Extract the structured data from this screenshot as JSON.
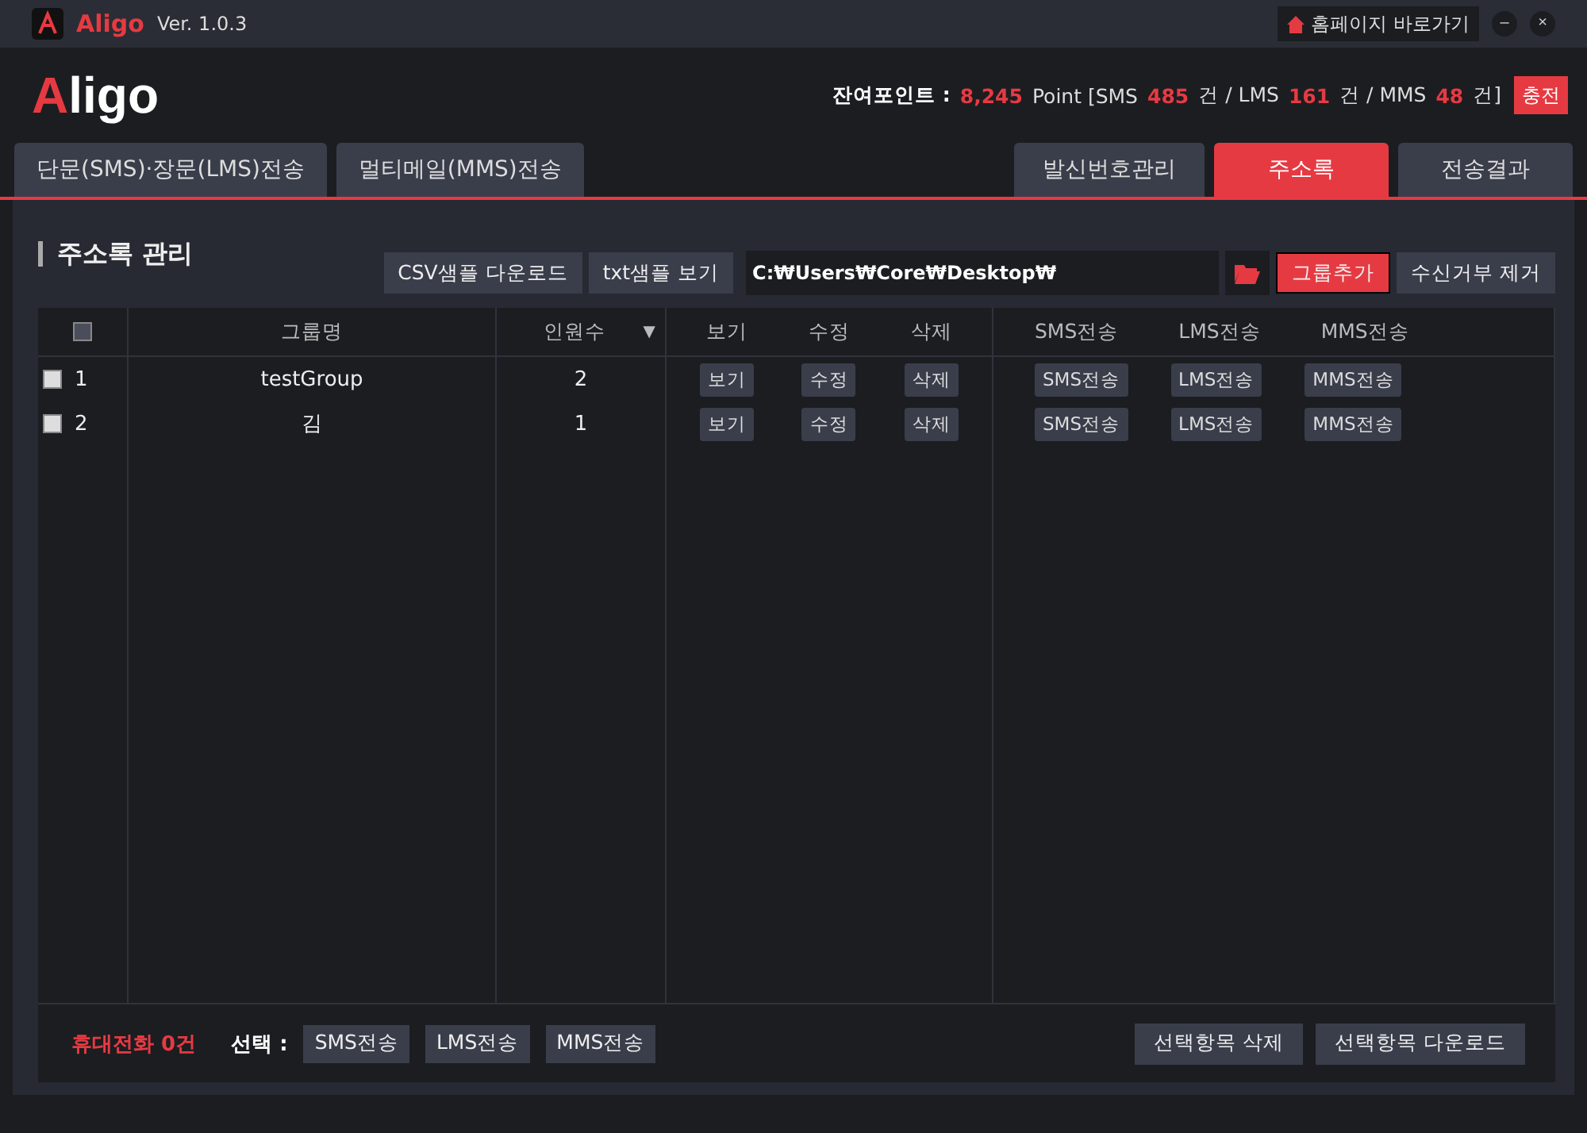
{
  "titlebar": {
    "app": "Aligo",
    "version": "Ver. 1.0.3",
    "homepage": "홈페이지 바로가기",
    "minimize": "–",
    "close": "×"
  },
  "header": {
    "logo": "Aligo",
    "points_label": "잔여포인트 :",
    "points_parts": [
      {
        "text": "8,245",
        "highlight": true
      },
      {
        "text": "Point [SMS",
        "highlight": false
      },
      {
        "text": "485",
        "highlight": true
      },
      {
        "text": "건 / LMS",
        "highlight": false
      },
      {
        "text": "161",
        "highlight": true
      },
      {
        "text": "건 / MMS",
        "highlight": false
      },
      {
        "text": "48",
        "highlight": true
      },
      {
        "text": "건]",
        "highlight": false
      }
    ],
    "charge": "충전"
  },
  "tabs_left": [
    {
      "label": "단문(SMS)·장문(LMS)전송",
      "selected": false
    },
    {
      "label": "멀티메일(MMS)전송",
      "selected": false
    }
  ],
  "tabs_right": [
    {
      "label": "발신번호관리",
      "selected": false
    },
    {
      "label": "주소록",
      "selected": true
    },
    {
      "label": "전송결과",
      "selected": false
    }
  ],
  "section": {
    "title": "주소록 관리",
    "csv_button": "CSV샘플 다운로드",
    "txt_button": "txt샘플 보기",
    "path": "C:₩Users₩Core₩Desktop₩",
    "add_group": "그룹추가",
    "remove_reject": "수신거부 제거"
  },
  "table": {
    "header_checked": false,
    "columns": [
      "그룹명",
      "인원수",
      "보기",
      "수정",
      "삭제",
      "SMS전송",
      "LMS전송",
      "MMS전송"
    ],
    "sort_mark": "▼",
    "rows": [
      {
        "checked": false,
        "no": "1",
        "group": "testGroup",
        "count": "2",
        "actions": [
          "보기",
          "수정",
          "삭제"
        ],
        "sends": [
          "SMS전송",
          "LMS전송",
          "MMS전송"
        ]
      },
      {
        "checked": false,
        "no": "2",
        "group": "김",
        "count": "1",
        "actions": [
          "보기",
          "수정",
          "삭제"
        ],
        "sends": [
          "SMS전송",
          "LMS전송",
          "MMS전송"
        ]
      }
    ]
  },
  "footer": {
    "phone_count": "휴대전화 0건",
    "select_label": "선택 :",
    "select_buttons": [
      "SMS전송",
      "LMS전송",
      "MMS전송"
    ],
    "right_buttons": [
      "선택항목 삭제",
      "선택항목 다운로드"
    ]
  }
}
